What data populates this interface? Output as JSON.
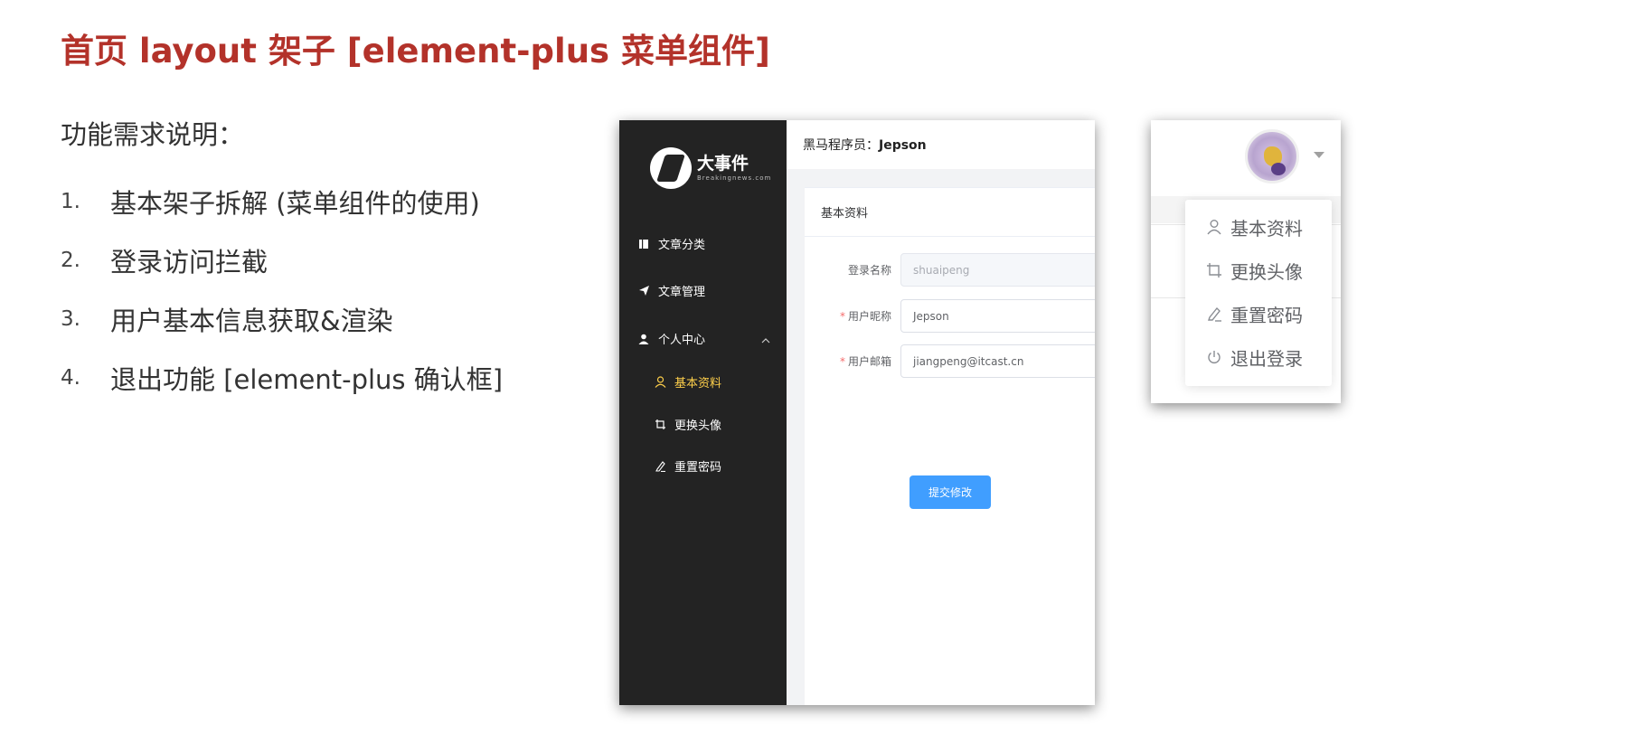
{
  "slide": {
    "title": "首页 layout 架子 [element-plus 菜单组件]",
    "requirements_heading": "功能需求说明：",
    "requirements": [
      {
        "num": "1.",
        "text": "基本架子拆解 (菜单组件的使用)"
      },
      {
        "num": "2.",
        "text": "登录访问拦截"
      },
      {
        "num": "3.",
        "text": "用户基本信息获取&渲染"
      },
      {
        "num": "4.",
        "text": "退出功能 [element-plus 确认框]"
      }
    ]
  },
  "app": {
    "logo": {
      "title": "大事件",
      "subtitle": "Breakingnews.com"
    },
    "menu": [
      {
        "label": "文章分类",
        "icon": "book-icon"
      },
      {
        "label": "文章管理",
        "icon": "send-icon"
      },
      {
        "label": "个人中心",
        "icon": "user-icon",
        "expanded": true
      }
    ],
    "submenu": [
      {
        "label": "基本资料",
        "icon": "user-outline-icon",
        "active": true
      },
      {
        "label": "更换头像",
        "icon": "crop-icon"
      },
      {
        "label": "重置密码",
        "icon": "edit-pen-icon"
      }
    ],
    "header": {
      "prefix": "黑马程序员：",
      "username": "Jepson"
    },
    "card": {
      "title": "基本资料",
      "fields": [
        {
          "label": "登录名称",
          "value": "shuaipeng",
          "required": false,
          "disabled": true
        },
        {
          "label": "用户昵称",
          "value": "Jepson",
          "required": true,
          "disabled": false
        },
        {
          "label": "用户邮箱",
          "value": "jiangpeng@itcast.cn",
          "required": true,
          "disabled": false
        }
      ],
      "submit_label": "提交修改"
    },
    "colors": {
      "aside": "#232323",
      "active": "#ffd04b",
      "primary": "#409eff",
      "title": "#b3322a"
    }
  },
  "dropdown": {
    "items": [
      {
        "label": "基本资料",
        "icon": "user-outline-icon"
      },
      {
        "label": "更换头像",
        "icon": "crop-icon"
      },
      {
        "label": "重置密码",
        "icon": "edit-pen-icon"
      },
      {
        "label": "退出登录",
        "icon": "power-icon"
      }
    ]
  }
}
